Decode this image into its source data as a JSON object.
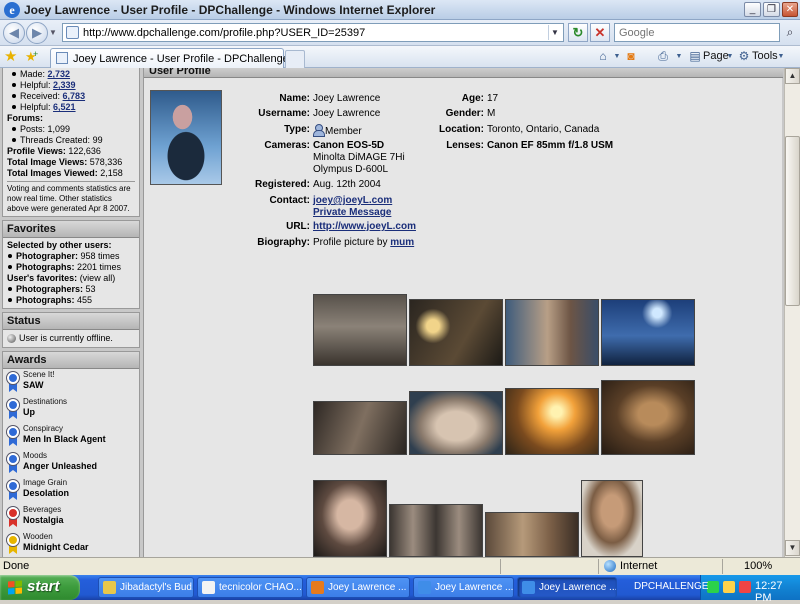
{
  "window": {
    "title": "Joey Lawrence - User Profile - DPChallenge - Windows Internet Explorer"
  },
  "address": {
    "url": "http://www.dpchallenge.com/profile.php?USER_ID=25397",
    "search_placeholder": "Google"
  },
  "tab": {
    "label": "Joey Lawrence - User Profile - DPChallenge"
  },
  "commands": {
    "page": "Page",
    "tools": "Tools"
  },
  "sidebar": {
    "stats": [
      {
        "label": "Made:",
        "value": "2,732",
        "link": true
      },
      {
        "label": "Helpful:",
        "value": "2,339",
        "link": true
      },
      {
        "label": "Received:",
        "value": "6,783",
        "link": true
      },
      {
        "label": "Helpful:",
        "value": "6,521",
        "link": true
      }
    ],
    "forums_label": "Forums:",
    "forum_stats": [
      {
        "label": "Posts:",
        "value": "1,099"
      },
      {
        "label": "Threads Created:",
        "value": "99"
      }
    ],
    "totals": [
      {
        "label": "Profile Views:",
        "value": "122,636"
      },
      {
        "label": "Total Image Views:",
        "value": "578,336"
      },
      {
        "label": "Total Images Viewed:",
        "value": "2,158"
      }
    ],
    "note": "Voting and comments statistics are now real time. Other statistics above were generated Apr 8 2007.",
    "favorites": {
      "title": "Favorites",
      "selected_by": "Selected by other users:",
      "items": [
        {
          "label": "Photographer:",
          "value": "958 times"
        },
        {
          "label": "Photographs:",
          "value": "2201 times"
        }
      ],
      "users_favorites": "User's favorites:",
      "view_all": "(view all)",
      "fav_items": [
        {
          "label": "Photographers:",
          "value": "53"
        },
        {
          "label": "Photographs:",
          "value": "455"
        }
      ]
    },
    "status": {
      "title": "Status",
      "text": "User is currently offline."
    },
    "awards": {
      "title": "Awards",
      "items": [
        {
          "category": "Scene It!",
          "name": "SAW",
          "color": "#2f6ad6"
        },
        {
          "category": "Destinations",
          "name": "Up",
          "color": "#2f6ad6"
        },
        {
          "category": "Conspiracy",
          "name": "Men In Black Agent",
          "color": "#2f6ad6"
        },
        {
          "category": "Moods",
          "name": "Anger Unleashed",
          "color": "#2f6ad6"
        },
        {
          "category": "Image Grain",
          "name": "Desolation",
          "color": "#2f6ad6"
        },
        {
          "category": "Beverages",
          "name": "Nostalgia",
          "color": "#d8312a"
        },
        {
          "category": "Wooden",
          "name": "Midnight Cedar",
          "color": "#e7b500"
        }
      ]
    }
  },
  "profile": {
    "section_title": "User Profile",
    "name_label": "Name:",
    "name": "Joey Lawrence",
    "username_label": "Username:",
    "username": "Joey Lawrence",
    "type_label": "Type:",
    "type": "Member",
    "cameras_label": "Cameras:",
    "cameras": [
      "Canon EOS-5D",
      "Minolta DiMAGE 7Hi",
      "Olympus D-600L"
    ],
    "registered_label": "Registered:",
    "registered": "Aug. 12th 2004",
    "contact_label": "Contact:",
    "email": "joey@joeyL.com",
    "pm": "Private Message",
    "url_label": "URL:",
    "url": "http://www.joeyL.com",
    "bio_label": "Biography:",
    "bio": "Profile picture by",
    "bio_link": "mum",
    "age_label": "Age:",
    "age": "17",
    "gender_label": "Gender:",
    "gender": "M",
    "location_label": "Location:",
    "location": "Toronto, Ontario, Canada",
    "lenses_label": "Lenses:",
    "lenses": "Canon EF 85mm f/1.8 USM"
  },
  "status_bar": {
    "text": "Done",
    "zone": "Internet",
    "zoom": "100%"
  },
  "taskbar": {
    "start": "start",
    "tasks": [
      {
        "label": "Jibadactyl's Bud...",
        "active": false,
        "icon_color": "#e9c74a"
      },
      {
        "label": "tecnicolor CHAO...",
        "active": false,
        "icon_color": "#f3f3f3"
      },
      {
        "label": "Joey Lawrence ...",
        "active": false,
        "icon_color": "#e67a1d"
      },
      {
        "label": "Joey Lawrence ...",
        "active": false,
        "icon_color": "#3f8de8"
      },
      {
        "label": "Joey Lawrence ...",
        "active": true,
        "icon_color": "#3f8de8"
      }
    ],
    "tray_label": "DPCHALLENGE",
    "clock": "12:27 PM"
  }
}
